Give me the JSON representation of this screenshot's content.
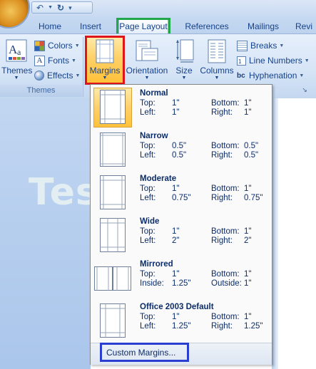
{
  "quick_access": {
    "undo_icon": "undo-icon",
    "redo_icon": "redo-icon",
    "save_icon": "save-icon"
  },
  "tabs": [
    {
      "label": "Home"
    },
    {
      "label": "Insert"
    },
    {
      "label": "Page Layout",
      "active": true
    },
    {
      "label": "References"
    },
    {
      "label": "Mailings"
    },
    {
      "label": "Revi"
    }
  ],
  "ribbon": {
    "themes_label": "Themes",
    "colors_label": "Colors",
    "fonts_label": "Fonts",
    "effects_label": "Effects",
    "themes_group_label": "Themes",
    "margins_label": "Margins",
    "orientation_label": "Orientation",
    "size_label": "Size",
    "columns_label": "Columns",
    "breaks_label": "Breaks",
    "line_numbers_label": "Line Numbers",
    "hyphenation_label": "Hyphenation",
    "hyphenation_icon_text": "bc"
  },
  "watermark": "Testbook",
  "margins_menu": {
    "items": [
      {
        "name": "Normal",
        "k1": "Top:",
        "v1": "1\"",
        "k2": "Bottom:",
        "v2": "1\"",
        "k3": "Left:",
        "v3": "1\"",
        "k4": "Right:",
        "v4": "1\""
      },
      {
        "name": "Narrow",
        "k1": "Top:",
        "v1": "0.5\"",
        "k2": "Bottom:",
        "v2": "0.5\"",
        "k3": "Left:",
        "v3": "0.5\"",
        "k4": "Right:",
        "v4": "0.5\""
      },
      {
        "name": "Moderate",
        "k1": "Top:",
        "v1": "1\"",
        "k2": "Bottom:",
        "v2": "1\"",
        "k3": "Left:",
        "v3": "0.75\"",
        "k4": "Right:",
        "v4": "0.75\""
      },
      {
        "name": "Wide",
        "k1": "Top:",
        "v1": "1\"",
        "k2": "Bottom:",
        "v2": "1\"",
        "k3": "Left:",
        "v3": "2\"",
        "k4": "Right:",
        "v4": "2\""
      },
      {
        "name": "Mirrored",
        "k1": "Top:",
        "v1": "1\"",
        "k2": "Bottom:",
        "v2": "1\"",
        "k3": "Inside:",
        "v3": "1.25\"",
        "k4": "Outside:",
        "v4": "1\""
      },
      {
        "name": "Office 2003 Default",
        "k1": "Top:",
        "v1": "1\"",
        "k2": "Bottom:",
        "v2": "1\"",
        "k3": "Left:",
        "v3": "1.25\"",
        "k4": "Right:",
        "v4": "1.25\""
      }
    ],
    "custom_label": "Custom Margins..."
  },
  "colors": {
    "accent_tab_highlight": "#22a84a",
    "margins_highlight": "#e0141b",
    "custom_margins_highlight": "#2a3fd0",
    "selected_item": "#ffd068"
  }
}
